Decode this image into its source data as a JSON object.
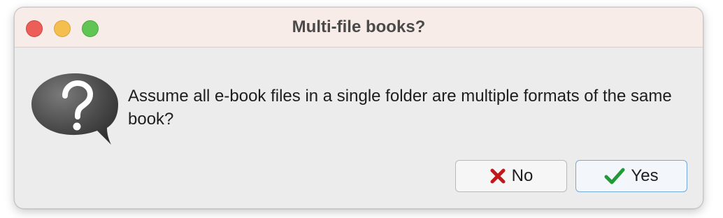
{
  "window": {
    "title": "Multi-file books?"
  },
  "dialog": {
    "icon": "question-icon",
    "message": "Assume all e-book files in a single folder are multiple formats of the same book?"
  },
  "buttons": {
    "no_label": "No",
    "no_icon": "x-icon",
    "yes_label": "Yes",
    "yes_icon": "checkmark-icon"
  },
  "colors": {
    "close": "#ec5f59",
    "minimize": "#f5bf4f",
    "maximize": "#61c555",
    "no_icon": "#c0181b",
    "yes_icon": "#1f9a36",
    "default_button_border": "#73a8e0"
  }
}
